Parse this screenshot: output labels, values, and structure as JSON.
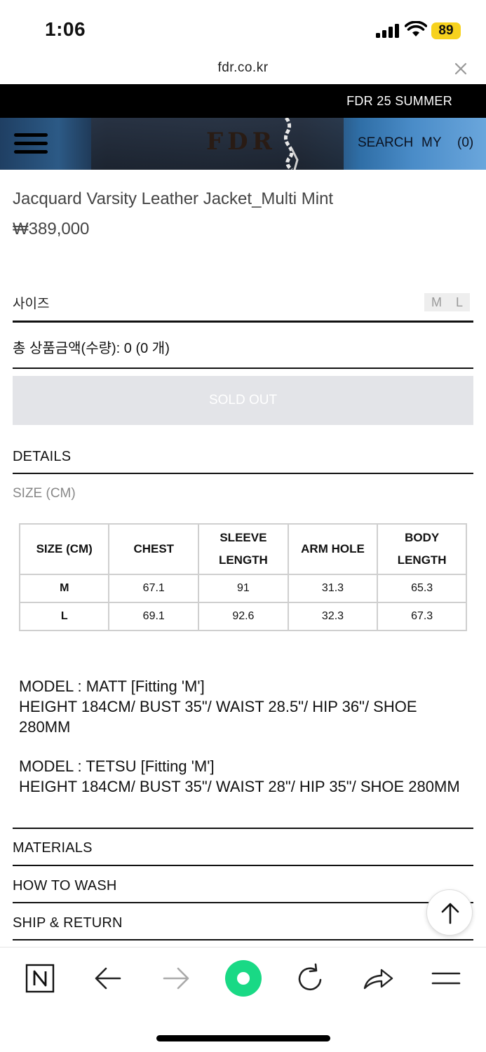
{
  "status": {
    "time": "1:06",
    "battery": "89"
  },
  "browser": {
    "url": "fdr.co.kr"
  },
  "promo": {
    "text": "FDR 25 SUMMER"
  },
  "header": {
    "logo": "FDR",
    "search": "SEARCH",
    "my": "MY",
    "cart": "(0)"
  },
  "product": {
    "title": "Jacquard Varsity Leather Jacket_Multi Mint",
    "price": "₩389,000",
    "size_label": "사이즈",
    "sizes": [
      "M",
      "L"
    ],
    "total_label": "총 상품금액(수량): 0 (0 개)",
    "soldout": "SOLD OUT"
  },
  "sections": {
    "details": "DETAILS",
    "size_caption": "SIZE (CM)",
    "materials": "MATERIALS",
    "how_to_wash": "HOW TO WASH",
    "ship_return": "SHIP & RETURN"
  },
  "size_table": {
    "headers": [
      "SIZE (CM)",
      "CHEST",
      "SLEEVE LENGTH",
      "ARM HOLE",
      "BODY LENGTH"
    ],
    "rows": [
      [
        "M",
        "67.1",
        "91",
        "31.3",
        "65.3"
      ],
      [
        "L",
        "69.1",
        "92.6",
        "32.3",
        "67.3"
      ]
    ]
  },
  "models": [
    {
      "line1": "MODEL : MATT [Fitting 'M']",
      "line2": "HEIGHT 184CM/ BUST 35\"/ WAIST 28.5\"/ HIP 36\"/ SHOE 280MM"
    },
    {
      "line1": "MODEL : TETSU [Fitting 'M']",
      "line2": "HEIGHT 184CM/ BUST 35\"/ WAIST 28\"/ HIP 35\"/ SHOE 280MM"
    }
  ],
  "colors": {
    "accent": "#19d985",
    "battery": "#f7d21e",
    "soldout_bg": "#e3e4e8"
  },
  "toolbar_icons": [
    "naver-n-icon",
    "back-arrow-icon",
    "forward-arrow-icon",
    "green-dot-icon",
    "reload-icon",
    "share-icon",
    "menu-icon"
  ]
}
